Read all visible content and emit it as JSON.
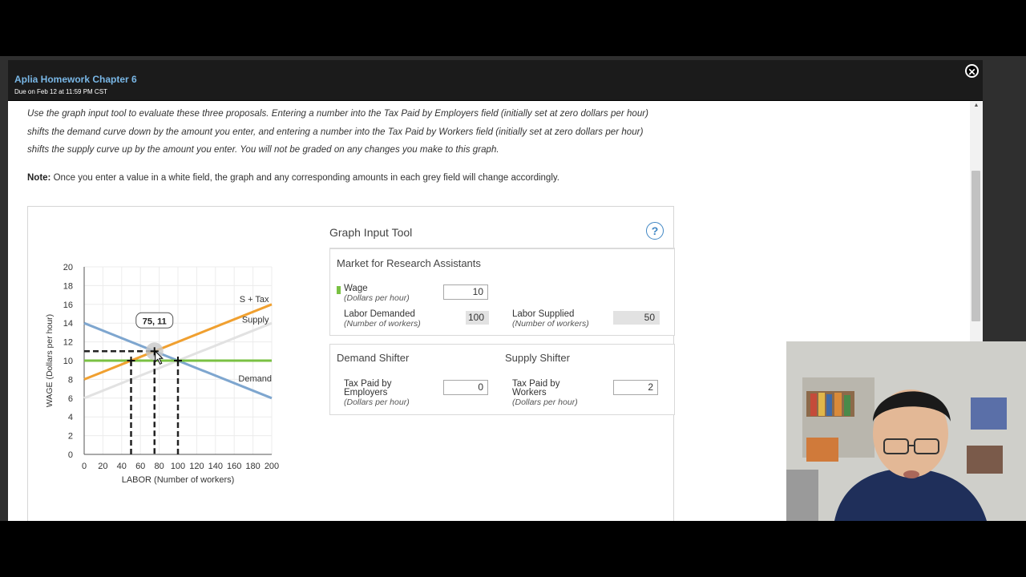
{
  "modal": {
    "title": "Aplia Homework Chapter 6",
    "due": "Due on Feb 12 at 11:59 PM CST"
  },
  "instructions": {
    "line1": "Use the graph input tool to evaluate these three proposals. Entering a number into the Tax Paid by Employers field (initially set at zero dollars per hour)",
    "line2": "shifts the demand curve down by the amount you enter, and entering a number into the Tax Paid by Workers field (initially set at zero dollars per hour)",
    "line3": "shifts the supply curve up by the amount you enter. You will not be graded on any changes you make to this graph.",
    "note_label": "Note:",
    "note_text": " Once you enter a value in a white field, the graph and any corresponding amounts in each grey field will change accordingly."
  },
  "tool": {
    "title": "Graph Input Tool",
    "help": "?",
    "market": {
      "title": "Market for Research Assistants",
      "wage_label": "Wage",
      "wage_unit": "(Dollars per hour)",
      "wage_value": "10",
      "demanded_label": "Labor Demanded",
      "demanded_unit": "(Number of workers)",
      "demanded_value": "100",
      "supplied_label": "Labor Supplied",
      "supplied_unit": "(Number of workers)",
      "supplied_value": "50"
    },
    "demand_shifter": {
      "title": "Demand Shifter",
      "label1": "Tax Paid by",
      "label2": "Employers",
      "unit": "(Dollars per hour)",
      "value": "0"
    },
    "supply_shifter": {
      "title": "Supply Shifter",
      "label1": "Tax Paid by",
      "label2": "Workers",
      "unit": "(Dollars per hour)",
      "value": "2"
    }
  },
  "chart_data": {
    "type": "line",
    "xlabel": "LABOR (Number of workers)",
    "ylabel": "WAGE (Dollars per hour)",
    "xlim": [
      0,
      200
    ],
    "ylim": [
      0,
      20
    ],
    "x_ticks": [
      "0",
      "20",
      "40",
      "60",
      "80",
      "100",
      "120",
      "140",
      "160",
      "180",
      "200"
    ],
    "y_ticks": [
      "0",
      "2",
      "4",
      "6",
      "8",
      "10",
      "12",
      "14",
      "16",
      "18",
      "20"
    ],
    "grid": true,
    "series": [
      {
        "name": "Demand",
        "color": "#7ea6cf",
        "points": [
          [
            0,
            14
          ],
          [
            200,
            6
          ]
        ]
      },
      {
        "name": "Supply",
        "color": "#e2e2e2",
        "points": [
          [
            0,
            6
          ],
          [
            200,
            14
          ]
        ]
      },
      {
        "name": "S + Tax",
        "color": "#f0a030",
        "points": [
          [
            0,
            8
          ],
          [
            200,
            16
          ]
        ]
      },
      {
        "name": "",
        "color": "#7ac143",
        "points": [
          [
            0,
            10
          ],
          [
            200,
            10
          ]
        ]
      }
    ],
    "tooltip": "75, 11",
    "tooltip_point": [
      75,
      11
    ],
    "guide_points": [
      [
        50,
        10
      ],
      [
        75,
        11
      ],
      [
        100,
        10
      ]
    ]
  },
  "colors": {
    "header_bg": "#1b1b1b",
    "title_blue": "#79b7e6",
    "help_blue": "#3f86c4",
    "wage_green": "#7ac143"
  }
}
